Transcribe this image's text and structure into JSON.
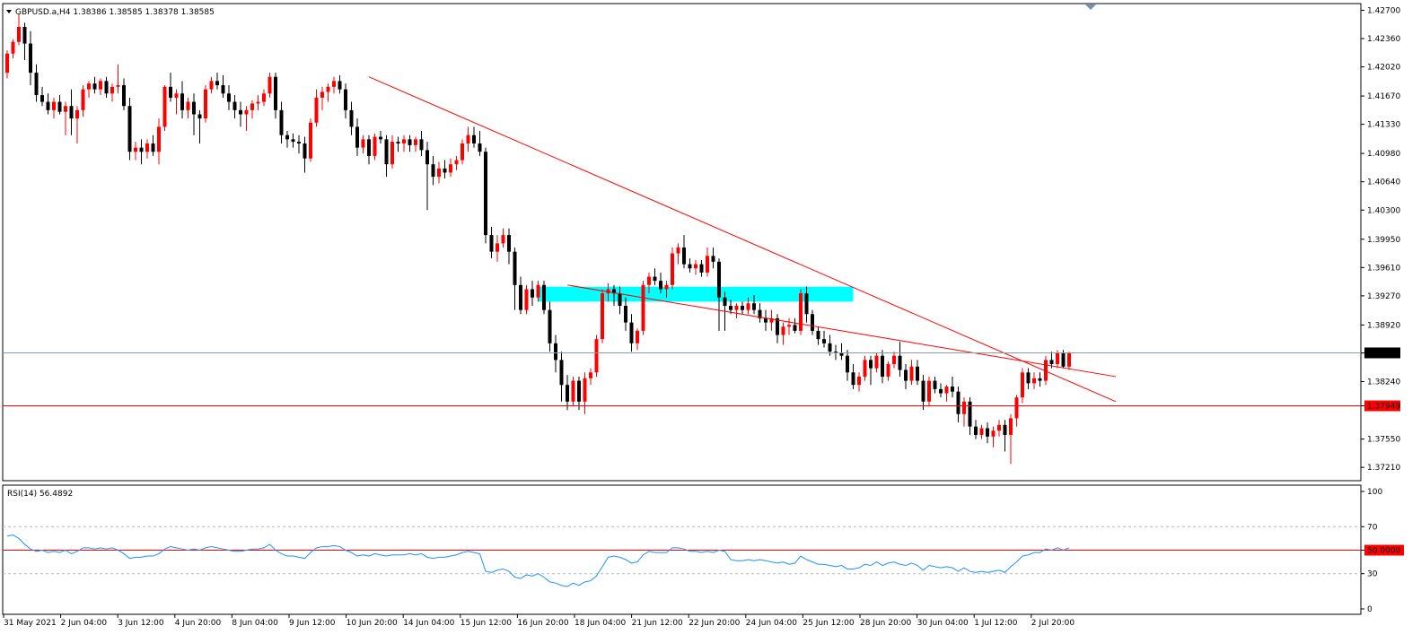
{
  "header": {
    "symbol_line": "GBPUSD.a,H4  1.38386 1.38585 1.38378 1.38585",
    "rsi_line": "RSI(14) 56.4892"
  },
  "colors": {
    "bull": "#ff0000",
    "bear": "#000000",
    "trendline": "#ff0000",
    "zone": "#00ffff",
    "rsi_line": "#1e90ff",
    "level_line": "#ff0000"
  },
  "price_axis": {
    "ticks": [
      "1.42700",
      "1.42360",
      "1.42020",
      "1.41670",
      "1.41330",
      "1.40980",
      "1.40640",
      "1.40300",
      "1.39950",
      "1.39610",
      "1.39270",
      "1.38920",
      "1.38585",
      "1.38240",
      "1.37949",
      "1.37550",
      "1.37210"
    ],
    "current_price": "1.38585",
    "level_price": "1.37949"
  },
  "rsi_axis": {
    "ticks": [
      "100",
      "70",
      "50.0000",
      "30",
      "0"
    ],
    "level": 50
  },
  "time_axis": {
    "labels": [
      "31 May 2021",
      "2 Jun 04:00",
      "3 Jun 12:00",
      "4 Jun 20:00",
      "8 Jun 04:00",
      "9 Jun 12:00",
      "10 Jun 20:00",
      "14 Jun 04:00",
      "15 Jun 12:00",
      "16 Jun 20:00",
      "18 Jun 04:00",
      "21 Jun 12:00",
      "22 Jun 20:00",
      "24 Jun 04:00",
      "25 Jun 12:00",
      "28 Jun 20:00",
      "30 Jun 04:00",
      "1 Jul 12:00",
      "2 Jul 20:00"
    ]
  },
  "chart_data": {
    "type": "candlestick",
    "symbol": "GBPUSD.a",
    "timeframe": "H4",
    "ylim": [
      1.3705,
      1.4278
    ],
    "bar_spacing": 6.5,
    "ohlc": [
      [
        1.4195,
        1.4222,
        1.4188,
        1.4218
      ],
      [
        1.4218,
        1.4235,
        1.4212,
        1.4232
      ],
      [
        1.4232,
        1.4265,
        1.4228,
        1.425
      ],
      [
        1.425,
        1.4255,
        1.421,
        1.423
      ],
      [
        1.423,
        1.4245,
        1.418,
        1.4195
      ],
      [
        1.4195,
        1.4205,
        1.416,
        1.4168
      ],
      [
        1.4168,
        1.4178,
        1.4155,
        1.416
      ],
      [
        1.416,
        1.417,
        1.4145,
        1.415
      ],
      [
        1.415,
        1.4165,
        1.414,
        1.416
      ],
      [
        1.416,
        1.4168,
        1.4145,
        1.4148
      ],
      [
        1.4148,
        1.416,
        1.412,
        1.4155
      ],
      [
        1.4155,
        1.4175,
        1.412,
        1.414
      ],
      [
        1.414,
        1.4155,
        1.411,
        1.415
      ],
      [
        1.415,
        1.418,
        1.4142,
        1.4175
      ],
      [
        1.4175,
        1.4185,
        1.4165,
        1.4182
      ],
      [
        1.4182,
        1.419,
        1.417,
        1.4175
      ],
      [
        1.4175,
        1.4188,
        1.4168,
        1.4185
      ],
      [
        1.4185,
        1.419,
        1.4165,
        1.417
      ],
      [
        1.417,
        1.4182,
        1.416,
        1.4178
      ],
      [
        1.4178,
        1.4205,
        1.417,
        1.418
      ],
      [
        1.418,
        1.4188,
        1.415,
        1.4155
      ],
      [
        1.4155,
        1.4165,
        1.409,
        1.41
      ],
      [
        1.41,
        1.4112,
        1.409,
        1.4105
      ],
      [
        1.4105,
        1.4115,
        1.4085,
        1.41
      ],
      [
        1.41,
        1.4115,
        1.4092,
        1.411
      ],
      [
        1.411,
        1.412,
        1.4095,
        1.41
      ],
      [
        1.41,
        1.414,
        1.4085,
        1.413
      ],
      [
        1.413,
        1.418,
        1.4125,
        1.4178
      ],
      [
        1.4178,
        1.4195,
        1.416,
        1.4165
      ],
      [
        1.4165,
        1.4175,
        1.4145,
        1.417
      ],
      [
        1.417,
        1.4185,
        1.414,
        1.415
      ],
      [
        1.415,
        1.4165,
        1.414,
        1.416
      ],
      [
        1.416,
        1.417,
        1.412,
        1.4145
      ],
      [
        1.4145,
        1.415,
        1.411,
        1.414
      ],
      [
        1.414,
        1.418,
        1.4135,
        1.4175
      ],
      [
        1.4175,
        1.419,
        1.417,
        1.4185
      ],
      [
        1.4185,
        1.4195,
        1.4175,
        1.418
      ],
      [
        1.418,
        1.4192,
        1.4165,
        1.417
      ],
      [
        1.417,
        1.418,
        1.415,
        1.416
      ],
      [
        1.416,
        1.4168,
        1.414,
        1.415
      ],
      [
        1.415,
        1.416,
        1.413,
        1.4145
      ],
      [
        1.4145,
        1.4155,
        1.4125,
        1.415
      ],
      [
        1.415,
        1.4162,
        1.414,
        1.4158
      ],
      [
        1.4158,
        1.4168,
        1.415,
        1.416
      ],
      [
        1.416,
        1.4175,
        1.4155,
        1.417
      ],
      [
        1.417,
        1.4195,
        1.4165,
        1.419
      ],
      [
        1.419,
        1.4195,
        1.414,
        1.415
      ],
      [
        1.415,
        1.416,
        1.411,
        1.412
      ],
      [
        1.412,
        1.4125,
        1.4105,
        1.4115
      ],
      [
        1.4115,
        1.4122,
        1.4105,
        1.4112
      ],
      [
        1.4112,
        1.412,
        1.4098,
        1.411
      ],
      [
        1.411,
        1.4118,
        1.4075,
        1.4092
      ],
      [
        1.4092,
        1.414,
        1.4088,
        1.4135
      ],
      [
        1.4135,
        1.4175,
        1.413,
        1.4165
      ],
      [
        1.4165,
        1.4178,
        1.415,
        1.4172
      ],
      [
        1.4172,
        1.4182,
        1.416,
        1.4178
      ],
      [
        1.4178,
        1.419,
        1.417,
        1.4185
      ],
      [
        1.4185,
        1.4192,
        1.417,
        1.4175
      ],
      [
        1.4175,
        1.4182,
        1.414,
        1.415
      ],
      [
        1.415,
        1.416,
        1.412,
        1.413
      ],
      [
        1.413,
        1.414,
        1.4095,
        1.4105
      ],
      [
        1.4105,
        1.412,
        1.4098,
        1.4115
      ],
      [
        1.4115,
        1.412,
        1.4085,
        1.4095
      ],
      [
        1.4095,
        1.4122,
        1.409,
        1.4118
      ],
      [
        1.4118,
        1.4125,
        1.411,
        1.4115
      ],
      [
        1.4115,
        1.412,
        1.407,
        1.4085
      ],
      [
        1.4085,
        1.412,
        1.408,
        1.4112
      ],
      [
        1.4112,
        1.4118,
        1.41,
        1.411
      ],
      [
        1.411,
        1.412,
        1.41,
        1.4115
      ],
      [
        1.4115,
        1.412,
        1.41,
        1.4108
      ],
      [
        1.4108,
        1.4118,
        1.41,
        1.4115
      ],
      [
        1.4115,
        1.4125,
        1.4095,
        1.4102
      ],
      [
        1.4102,
        1.4112,
        1.403,
        1.4085
      ],
      [
        1.4085,
        1.4095,
        1.406,
        1.407
      ],
      [
        1.407,
        1.4088,
        1.4062,
        1.408
      ],
      [
        1.408,
        1.409,
        1.4068,
        1.4075
      ],
      [
        1.4075,
        1.4092,
        1.407,
        1.4085
      ],
      [
        1.4085,
        1.4095,
        1.4078,
        1.409
      ],
      [
        1.409,
        1.4115,
        1.4085,
        1.411
      ],
      [
        1.411,
        1.413,
        1.41,
        1.412
      ],
      [
        1.412,
        1.413,
        1.4105,
        1.411
      ],
      [
        1.411,
        1.4125,
        1.4095,
        1.41
      ],
      [
        1.41,
        1.4105,
        1.399,
        1.4
      ],
      [
        1.4,
        1.401,
        1.3972,
        1.398
      ],
      [
        1.398,
        1.4,
        1.3968,
        1.399
      ],
      [
        1.399,
        1.4008,
        1.3985,
        1.4
      ],
      [
        1.4,
        1.4008,
        1.3965,
        1.398
      ],
      [
        1.398,
        1.3985,
        1.391,
        1.394
      ],
      [
        1.394,
        1.395,
        1.3905,
        1.391
      ],
      [
        1.391,
        1.394,
        1.3905,
        1.3935
      ],
      [
        1.3935,
        1.3945,
        1.3915,
        1.3925
      ],
      [
        1.3925,
        1.3945,
        1.392,
        1.394
      ],
      [
        1.394,
        1.3945,
        1.3905,
        1.391
      ],
      [
        1.391,
        1.392,
        1.386,
        1.387
      ],
      [
        1.387,
        1.388,
        1.3835,
        1.385
      ],
      [
        1.385,
        1.386,
        1.38,
        1.382
      ],
      [
        1.382,
        1.3832,
        1.379,
        1.38
      ],
      [
        1.38,
        1.383,
        1.3795,
        1.3825
      ],
      [
        1.3825,
        1.383,
        1.379,
        1.38
      ],
      [
        1.38,
        1.3835,
        1.3785,
        1.3828
      ],
      [
        1.3828,
        1.384,
        1.382,
        1.3835
      ],
      [
        1.3835,
        1.388,
        1.383,
        1.3875
      ],
      [
        1.3875,
        1.3935,
        1.387,
        1.393
      ],
      [
        1.393,
        1.3942,
        1.392,
        1.3935
      ],
      [
        1.3935,
        1.394,
        1.3915,
        1.393
      ],
      [
        1.393,
        1.3938,
        1.3905,
        1.3915
      ],
      [
        1.3915,
        1.3925,
        1.3885,
        1.3895
      ],
      [
        1.3895,
        1.3905,
        1.386,
        1.387
      ],
      [
        1.387,
        1.3888,
        1.3862,
        1.3885
      ],
      [
        1.3885,
        1.3945,
        1.388,
        1.394
      ],
      [
        1.394,
        1.3955,
        1.393,
        1.395
      ],
      [
        1.395,
        1.396,
        1.394,
        1.3945
      ],
      [
        1.3945,
        1.3955,
        1.393,
        1.3935
      ],
      [
        1.3935,
        1.3945,
        1.3925,
        1.394
      ],
      [
        1.394,
        1.3985,
        1.3935,
        1.3978
      ],
      [
        1.3978,
        1.399,
        1.3965,
        1.3985
      ],
      [
        1.3985,
        1.4,
        1.396,
        1.3965
      ],
      [
        1.3965,
        1.3972,
        1.3955,
        1.396
      ],
      [
        1.396,
        1.397,
        1.3952,
        1.3965
      ],
      [
        1.3965,
        1.397,
        1.395,
        1.3955
      ],
      [
        1.3955,
        1.3985,
        1.395,
        1.3975
      ],
      [
        1.3975,
        1.3985,
        1.396,
        1.3968
      ],
      [
        1.3968,
        1.3972,
        1.3885,
        1.3925
      ],
      [
        1.3925,
        1.3932,
        1.3885,
        1.3915
      ],
      [
        1.3915,
        1.3922,
        1.3905,
        1.391
      ],
      [
        1.391,
        1.3918,
        1.39,
        1.3915
      ],
      [
        1.3915,
        1.392,
        1.3905,
        1.391
      ],
      [
        1.391,
        1.3925,
        1.3905,
        1.3918
      ],
      [
        1.3918,
        1.3928,
        1.3905,
        1.391
      ],
      [
        1.391,
        1.3918,
        1.3895,
        1.39
      ],
      [
        1.39,
        1.391,
        1.3885,
        1.3895
      ],
      [
        1.3895,
        1.391,
        1.3885,
        1.39
      ],
      [
        1.39,
        1.3905,
        1.387,
        1.388
      ],
      [
        1.388,
        1.3895,
        1.3868,
        1.389
      ],
      [
        1.389,
        1.39,
        1.388,
        1.3892
      ],
      [
        1.3892,
        1.39,
        1.3882,
        1.3885
      ],
      [
        1.3885,
        1.3935,
        1.388,
        1.393
      ],
      [
        1.393,
        1.3938,
        1.3895,
        1.3905
      ],
      [
        1.3905,
        1.391,
        1.388,
        1.3885
      ],
      [
        1.3885,
        1.389,
        1.3868,
        1.3875
      ],
      [
        1.3875,
        1.3885,
        1.3865,
        1.387
      ],
      [
        1.387,
        1.388,
        1.3855,
        1.386
      ],
      [
        1.386,
        1.3868,
        1.385,
        1.3858
      ],
      [
        1.3858,
        1.387,
        1.385,
        1.3855
      ],
      [
        1.3855,
        1.3862,
        1.3825,
        1.3835
      ],
      [
        1.3835,
        1.3845,
        1.3815,
        1.382
      ],
      [
        1.382,
        1.3835,
        1.3812,
        1.383
      ],
      [
        1.383,
        1.3855,
        1.3825,
        1.385
      ],
      [
        1.385,
        1.3855,
        1.382,
        1.384
      ],
      [
        1.384,
        1.3858,
        1.3835,
        1.3855
      ],
      [
        1.3855,
        1.3862,
        1.3822,
        1.383
      ],
      [
        1.383,
        1.3848,
        1.3825,
        1.3845
      ],
      [
        1.3845,
        1.386,
        1.384,
        1.3855
      ],
      [
        1.3855,
        1.3872,
        1.383,
        1.3838
      ],
      [
        1.3838,
        1.3845,
        1.3815,
        1.3825
      ],
      [
        1.3825,
        1.385,
        1.382,
        1.3842
      ],
      [
        1.3842,
        1.385,
        1.382,
        1.3825
      ],
      [
        1.3825,
        1.3832,
        1.379,
        1.38
      ],
      [
        1.38,
        1.383,
        1.3795,
        1.3825
      ],
      [
        1.3825,
        1.383,
        1.381,
        1.3815
      ],
      [
        1.3815,
        1.3822,
        1.3805,
        1.381
      ],
      [
        1.381,
        1.382,
        1.38,
        1.3818
      ],
      [
        1.3818,
        1.383,
        1.3805,
        1.3812
      ],
      [
        1.3812,
        1.3818,
        1.3775,
        1.3785
      ],
      [
        1.3785,
        1.3805,
        1.377,
        1.38
      ],
      [
        1.38,
        1.3805,
        1.376,
        1.377
      ],
      [
        1.377,
        1.3778,
        1.3755,
        1.376
      ],
      [
        1.376,
        1.3772,
        1.3755,
        1.3768
      ],
      [
        1.3768,
        1.3775,
        1.375,
        1.3758
      ],
      [
        1.3758,
        1.377,
        1.3745,
        1.3765
      ],
      [
        1.3765,
        1.3778,
        1.3758,
        1.3772
      ],
      [
        1.3772,
        1.3778,
        1.374,
        1.376
      ],
      [
        1.376,
        1.3785,
        1.3725,
        1.378
      ],
      [
        1.378,
        1.3808,
        1.377,
        1.3805
      ],
      [
        1.3805,
        1.384,
        1.3798,
        1.3835
      ],
      [
        1.3835,
        1.384,
        1.3815,
        1.3822
      ],
      [
        1.3822,
        1.3835,
        1.3815,
        1.3828
      ],
      [
        1.3828,
        1.3835,
        1.3818,
        1.3825
      ],
      [
        1.3825,
        1.3855,
        1.382,
        1.385
      ],
      [
        1.385,
        1.386,
        1.384,
        1.3845
      ],
      [
        1.3845,
        1.3862,
        1.384,
        1.3858
      ],
      [
        1.3858,
        1.3862,
        1.384,
        1.3842
      ],
      [
        1.3842,
        1.386,
        1.3838,
        1.3858
      ]
    ],
    "rsi": [
      62,
      63,
      60,
      55,
      51,
      49,
      50,
      48,
      49,
      48,
      50,
      47,
      49,
      52,
      52,
      51,
      52,
      51,
      52,
      50,
      47,
      43,
      44,
      44,
      45,
      45,
      47,
      51,
      53,
      52,
      51,
      50,
      51,
      50,
      52,
      53,
      52,
      51,
      50,
      49,
      49,
      50,
      51,
      51,
      52,
      55,
      50,
      47,
      45,
      45,
      44,
      43,
      48,
      52,
      53,
      53,
      54,
      53,
      50,
      48,
      45,
      46,
      45,
      47,
      46,
      45,
      46,
      46,
      46,
      47,
      46,
      47,
      44,
      43,
      44,
      44,
      45,
      46,
      48,
      49,
      48,
      47,
      32,
      31,
      33,
      34,
      32,
      27,
      26,
      29,
      28,
      30,
      27,
      23,
      22,
      20,
      19,
      22,
      20,
      23,
      24,
      28,
      36,
      44,
      45,
      44,
      42,
      39,
      40,
      46,
      49,
      48,
      48,
      48,
      52,
      52,
      51,
      49,
      49,
      48,
      49,
      48,
      50,
      49,
      42,
      41,
      41,
      42,
      41,
      42,
      41,
      40,
      39,
      40,
      38,
      39,
      45,
      42,
      40,
      38,
      38,
      37,
      36,
      37,
      34,
      34,
      35,
      38,
      37,
      40,
      37,
      39,
      40,
      38,
      37,
      39,
      37,
      33,
      37,
      36,
      35,
      36,
      35,
      32,
      35,
      32,
      31,
      32,
      31,
      32,
      33,
      31,
      36,
      40,
      45,
      46,
      48,
      48,
      51,
      50,
      52,
      50,
      52
    ],
    "zone": {
      "from_bar": 91,
      "to_bar": 145,
      "price_top": 1.3938,
      "price_bottom": 1.392
    },
    "trendlines": [
      {
        "from_bar": 62,
        "from_price": 1.419,
        "to_bar": 190,
        "to_price": 1.38
      },
      {
        "from_bar": 96,
        "from_price": 1.394,
        "to_bar": 190,
        "to_price": 1.383
      }
    ],
    "rsi_ylim": [
      0,
      100
    ]
  }
}
